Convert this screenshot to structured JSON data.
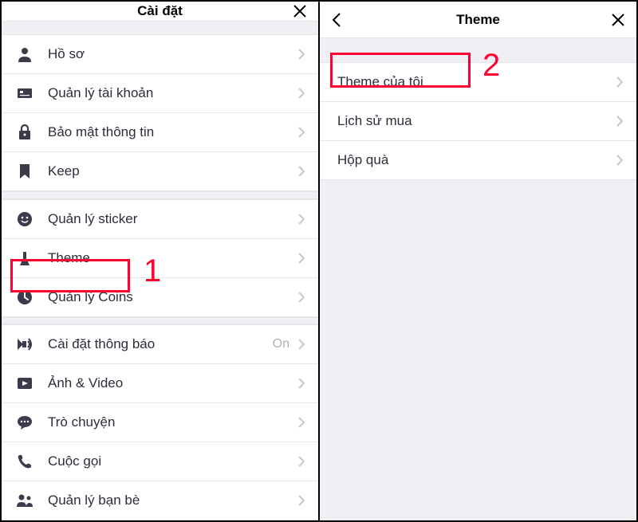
{
  "left": {
    "title": "Cài đặt",
    "groups": [
      [
        {
          "icon": "profile-icon",
          "label": "Hồ sơ"
        },
        {
          "icon": "account-icon",
          "label": "Quản lý tài khoản"
        },
        {
          "icon": "lock-icon",
          "label": "Bảo mật thông tin"
        },
        {
          "icon": "keep-icon",
          "label": "Keep"
        }
      ],
      [
        {
          "icon": "sticker-icon",
          "label": "Quản lý sticker"
        },
        {
          "icon": "theme-icon",
          "label": "Theme",
          "highlight": 1
        },
        {
          "icon": "coins-icon",
          "label": "Quản lý Coins"
        }
      ],
      [
        {
          "icon": "notify-icon",
          "label": "Cài đặt thông báo",
          "value": "On"
        },
        {
          "icon": "media-icon",
          "label": "Ảnh & Video"
        },
        {
          "icon": "chat-icon",
          "label": "Trò chuyện"
        },
        {
          "icon": "call-icon",
          "label": "Cuộc gọi"
        },
        {
          "icon": "friends-icon",
          "label": "Quản lý bạn bè"
        }
      ]
    ]
  },
  "right": {
    "title": "Theme",
    "items": [
      {
        "label": "Theme của tôi",
        "highlight": 2
      },
      {
        "label": "Lịch sử mua"
      },
      {
        "label": "Hộp quà"
      }
    ]
  },
  "annotations": {
    "num1": "1",
    "num2": "2"
  }
}
